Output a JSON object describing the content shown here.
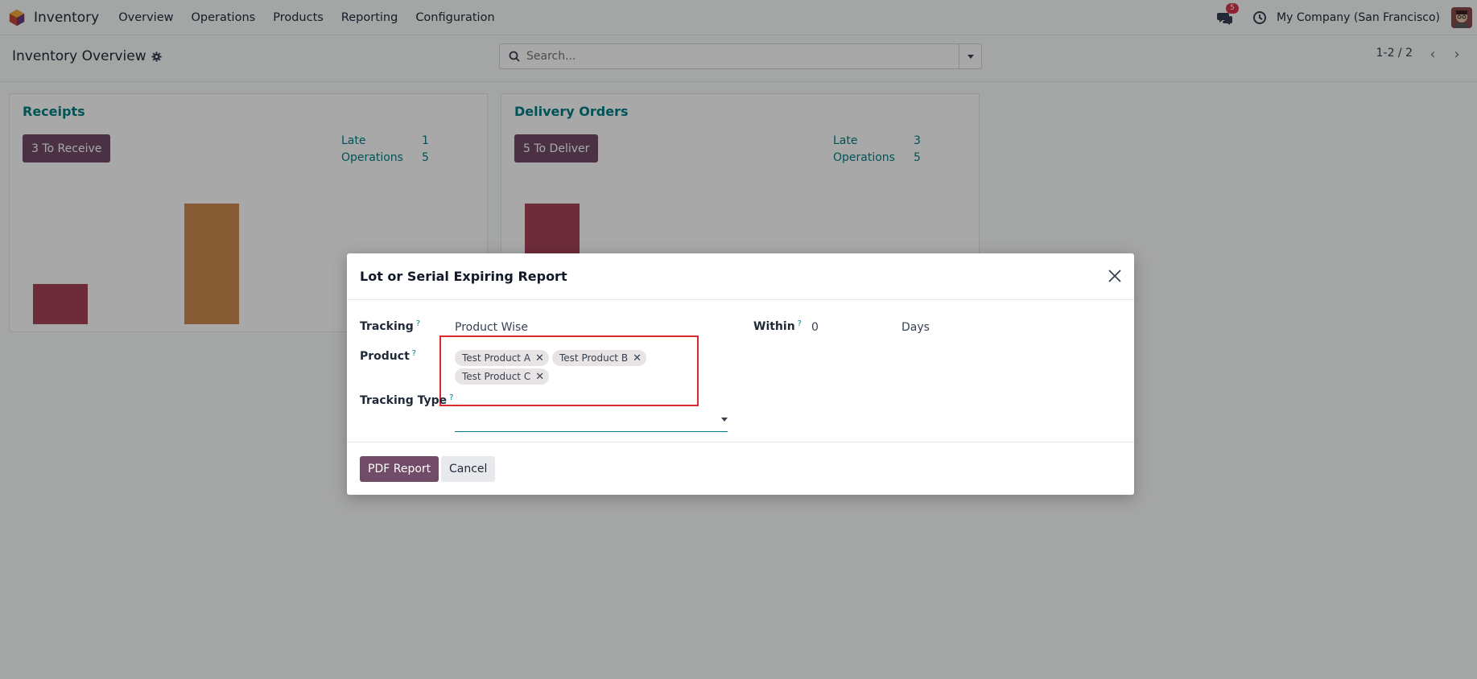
{
  "navbar": {
    "app_name": "Inventory",
    "menu": [
      "Overview",
      "Operations",
      "Products",
      "Reporting",
      "Configuration"
    ],
    "chat_badge": "5",
    "company": "My Company (San Francisco)"
  },
  "control": {
    "breadcrumb": "Inventory Overview",
    "search_placeholder": "Search...",
    "pager": "1-2 / 2"
  },
  "cards": [
    {
      "title": "Receipts",
      "button": "3 To Receive",
      "late_label": "Late",
      "late_value": "1",
      "ops_label": "Operations",
      "ops_value": "5",
      "bars": [
        {
          "color": "#a8445a",
          "value": 0.33
        },
        {
          "color": "#c98a4c",
          "value": 1.0
        }
      ]
    },
    {
      "title": "Delivery Orders",
      "button": "5 To Deliver",
      "late_label": "Late",
      "late_value": "3",
      "ops_label": "Operations",
      "ops_value": "5",
      "bars": [
        {
          "color": "#a8445a",
          "value": 1.0
        }
      ]
    }
  ],
  "modal": {
    "title": "Lot or Serial Expiring Report",
    "tracking_label": "Tracking",
    "tracking_value": "Product Wise",
    "within_label": "Within",
    "within_value": "0",
    "within_unit": "Days",
    "product_label": "Product",
    "products": [
      "Test Product A",
      "Test Product B",
      "Test Product C"
    ],
    "tracking_type_label": "Tracking Type",
    "tracking_type_value": "",
    "help_mark": "?",
    "pdf_button": "PDF Report",
    "cancel_button": "Cancel"
  },
  "colors": {
    "brand": "#714b67",
    "accent": "#017e84",
    "highlight": "#d92b2b"
  }
}
